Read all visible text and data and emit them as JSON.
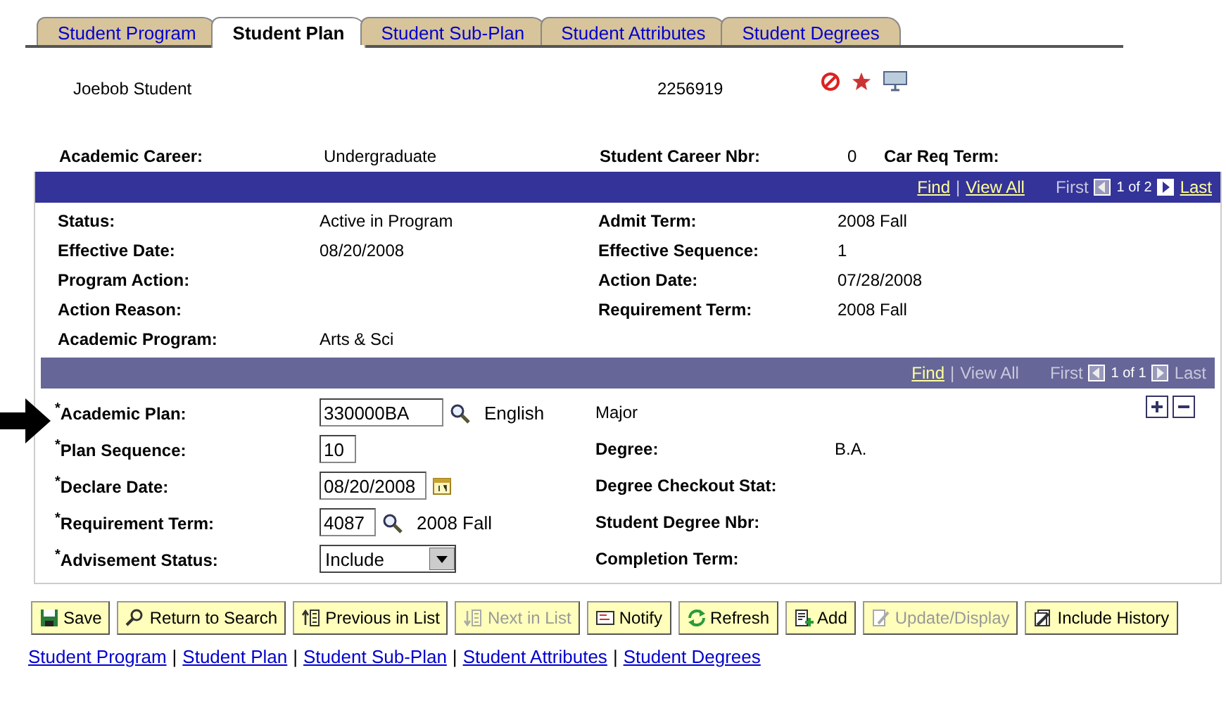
{
  "tabs": [
    {
      "label": "Student Program",
      "selected": false
    },
    {
      "label": "Student Plan",
      "selected": true
    },
    {
      "label": "Student Sub-Plan",
      "selected": false
    },
    {
      "label": "Student Attributes",
      "selected": false
    },
    {
      "label": "Student Degrees",
      "selected": false
    }
  ],
  "header": {
    "name": "Joebob Student",
    "id": "2256919"
  },
  "career": [
    {
      "label": "Academic Career:",
      "value": "Undergraduate"
    },
    {
      "label": "Student Career Nbr:",
      "value": "0"
    },
    {
      "label": "Car Req Term:"
    }
  ],
  "program_section": {
    "nav": [
      {
        "kind": "link",
        "text": "Find"
      },
      {
        "kind": "sep",
        "text": "|"
      },
      {
        "kind": "link",
        "text": "View All"
      },
      {
        "kind": "text",
        "text": "First"
      },
      {
        "kind": "prev",
        "disabled": true
      },
      {
        "kind": "count",
        "text": "1 of 2"
      },
      {
        "kind": "next",
        "disabled": false
      },
      {
        "kind": "link",
        "text": "Last"
      }
    ],
    "rows": [
      {
        "left_label": "Status:",
        "left_value": "Active in Program",
        "right_label": "Admit Term:",
        "right_value": "2008 Fall"
      },
      {
        "left_label": "Effective Date:",
        "left_value": "08/20/2008",
        "right_label": "Effective Sequence:",
        "right_value": "1"
      },
      {
        "left_label": "Program Action:",
        "right_label": "Action Date:",
        "right_value": "07/28/2008"
      },
      {
        "left_label": "Action Reason:",
        "right_label": "Requirement Term:",
        "right_value": "2008 Fall"
      },
      {
        "left_label": "Academic Program:",
        "left_value": "Arts & Sci"
      }
    ]
  },
  "plan_section": {
    "nav": [
      {
        "kind": "link",
        "text": "Find"
      },
      {
        "kind": "sep",
        "text": "|"
      },
      {
        "kind": "text",
        "text": "View All"
      },
      {
        "kind": "text",
        "text": "First"
      },
      {
        "kind": "prev",
        "disabled": true
      },
      {
        "kind": "count",
        "text": "1 of 1"
      },
      {
        "kind": "next",
        "disabled": true
      },
      {
        "kind": "text",
        "text": "Last"
      }
    ],
    "rows": [
      {
        "label": "$^{*}$Academic Plan:",
        "kind": "lookup",
        "value": "330000BA",
        "description": "English",
        "right_value": "Major"
      },
      {
        "label": "$^{*}$Plan Sequence:",
        "kind": "input",
        "value": "10",
        "right_label": "Degree:",
        "right_value": "B.A."
      },
      {
        "label": "$^{*}$Declare Date:",
        "kind": "date",
        "value": "08/20/2008",
        "right_label": "Degree Checkout Stat:"
      },
      {
        "label": "$^{*}$Requirement Term:",
        "kind": "lookup",
        "value": "4087",
        "description": "2008 Fall",
        "right_label": "Student Degree Nbr:"
      },
      {
        "label": "$^{*}$Advisement Status:",
        "kind": "select",
        "value": "Include",
        "right_label": "Completion Term:"
      }
    ]
  },
  "buttons": [
    {
      "label": "Save",
      "kind": "save",
      "disabled": false
    },
    {
      "label": "Return to Search",
      "kind": "search",
      "disabled": false
    },
    {
      "label": "Previous in List",
      "kind": "prev",
      "disabled": false
    },
    {
      "label": "Next in List",
      "kind": "next",
      "disabled": true
    },
    {
      "label": "Notify",
      "kind": "notify",
      "disabled": false
    },
    {
      "label": "Refresh",
      "kind": "refresh",
      "disabled": false
    },
    {
      "label": "Add",
      "kind": "add",
      "disabled": false
    },
    {
      "label": "Update/Display",
      "kind": "update",
      "disabled": true
    },
    {
      "label": "Include History",
      "kind": "history",
      "disabled": false
    }
  ],
  "links": [
    {
      "kind": "link",
      "text": "Student Program"
    },
    {
      "kind": "sep",
      "text": "|"
    },
    {
      "kind": "link",
      "text": "Student Plan"
    },
    {
      "kind": "sep",
      "text": "|"
    },
    {
      "kind": "link",
      "text": "Student Sub-Plan"
    },
    {
      "kind": "sep",
      "text": "|"
    },
    {
      "kind": "link",
      "text": "Student Attributes"
    },
    {
      "kind": "sep",
      "text": "|"
    },
    {
      "kind": "link",
      "text": "Student Degrees"
    }
  ]
}
